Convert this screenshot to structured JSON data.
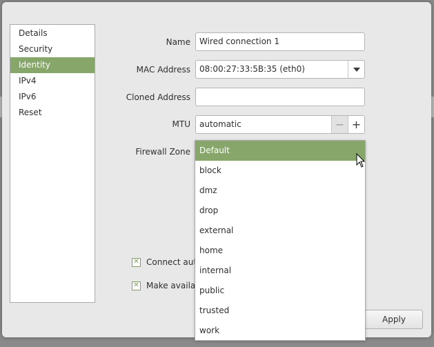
{
  "sidebar": {
    "items": [
      {
        "label": "Details"
      },
      {
        "label": "Security"
      },
      {
        "label": "Identity"
      },
      {
        "label": "IPv4"
      },
      {
        "label": "IPv6"
      },
      {
        "label": "Reset"
      }
    ],
    "active_index": 2
  },
  "form": {
    "name_label": "Name",
    "name_value": "Wired connection 1",
    "mac_label": "MAC Address",
    "mac_value": "08:00:27:33:5B:35 (eth0)",
    "cloned_label": "Cloned Address",
    "cloned_value": "",
    "mtu_label": "MTU",
    "mtu_value": "automatic",
    "mtu_minus": "−",
    "mtu_plus": "+",
    "firewall_label": "Firewall Zone"
  },
  "checks": {
    "connect_auto_label": "Connect auto",
    "make_available_label": "Make availab"
  },
  "apply_label": "Apply",
  "firewall_dropdown": {
    "selected": "Default",
    "options": [
      "Default",
      "block",
      "dmz",
      "drop",
      "external",
      "home",
      "internal",
      "public",
      "trusted",
      "work"
    ]
  },
  "colors": {
    "accent": "#86a769",
    "window_bg": "#e8e8e8"
  }
}
